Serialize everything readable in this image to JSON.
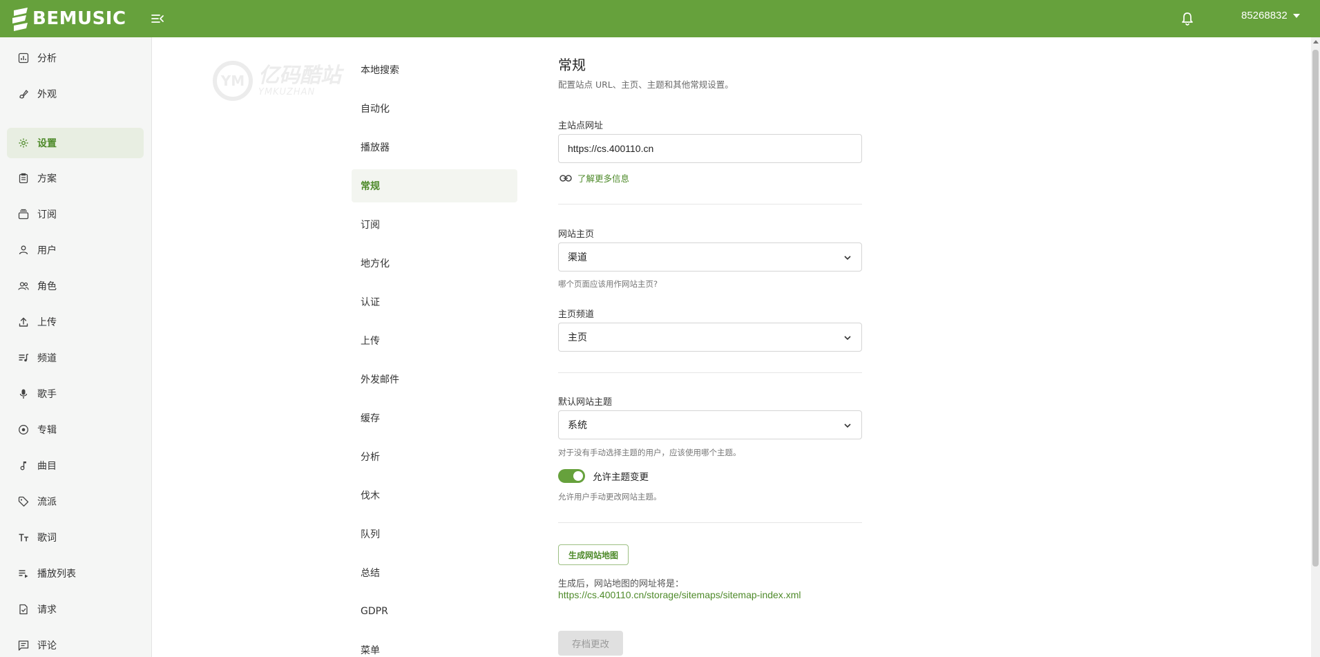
{
  "app": {
    "brand": "BEMUSIC",
    "username": "85268832"
  },
  "icons": {
    "menu_toggle": "menu-collapse-icon",
    "notifications": "bell-icon",
    "user_menu": "caret-down-icon"
  },
  "colors": {
    "brand": "#66a13c",
    "accent_text": "#4e8a2a",
    "active_bg": "#e8eee2"
  },
  "watermark": {
    "text_cn": "亿码酷站",
    "text_en": "YMKUZHAN",
    "mark": "YM"
  },
  "sidebar": {
    "items": [
      {
        "label": "分析",
        "icon": "chart-icon"
      },
      {
        "label": "外观",
        "icon": "brush-icon"
      },
      {
        "label": "设置",
        "icon": "gear-icon",
        "active": true
      },
      {
        "label": "方案",
        "icon": "clipboard-icon"
      },
      {
        "label": "订阅",
        "icon": "subscription-icon"
      },
      {
        "label": "用户",
        "icon": "user-icon"
      },
      {
        "label": "角色",
        "icon": "users-icon"
      },
      {
        "label": "上传",
        "icon": "upload-icon"
      },
      {
        "label": "频道",
        "icon": "channel-list-icon"
      },
      {
        "label": "歌手",
        "icon": "microphone-icon"
      },
      {
        "label": "专辑",
        "icon": "album-icon"
      },
      {
        "label": "曲目",
        "icon": "music-note-icon"
      },
      {
        "label": "流派",
        "icon": "tag-icon"
      },
      {
        "label": "歌词",
        "icon": "text-size-icon"
      },
      {
        "label": "播放列表",
        "icon": "playlist-icon"
      },
      {
        "label": "请求",
        "icon": "request-icon"
      },
      {
        "label": "评论",
        "icon": "comment-icon"
      }
    ]
  },
  "settings_nav": {
    "items": [
      "本地搜索",
      "自动化",
      "播放器",
      "常规",
      "订阅",
      "地方化",
      "认证",
      "上传",
      "外发邮件",
      "缓存",
      "分析",
      "伐木",
      "队列",
      "总结",
      "GDPR",
      "菜单"
    ],
    "active": "常规"
  },
  "main": {
    "title": "常规",
    "subtitle": "配置站点 URL、主页、主题和其他常规设置。",
    "site_url": {
      "label": "主站点网址",
      "value": "https://cs.400110.cn",
      "learn_more": "了解更多信息"
    },
    "homepage": {
      "label": "网站主页",
      "value": "渠道",
      "hint": "哪个页面应该用作网站主页?"
    },
    "home_channel": {
      "label": "主页频道",
      "value": "主页"
    },
    "theme": {
      "label": "默认网站主题",
      "value": "系统",
      "hint": "对于没有手动选择主题的用户，应该使用哪个主题。"
    },
    "theme_toggle": {
      "label": "允许主题变更",
      "checked": true,
      "hint": "允许用户手动更改网站主题。"
    },
    "sitemap": {
      "button": "生成网站地图",
      "text": "生成后，网站地图的网址将是：",
      "url": "https://cs.400110.cn/storage/sitemaps/sitemap-index.xml"
    },
    "save_button": "存档更改"
  }
}
